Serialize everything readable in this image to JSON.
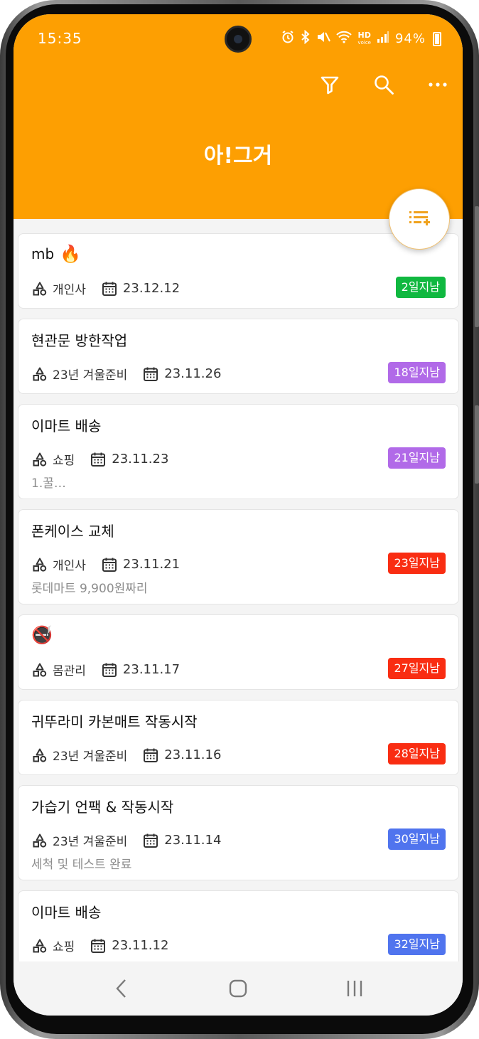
{
  "status_bar": {
    "time": "15:35",
    "battery": "94%",
    "hd_label": "HD",
    "hd_sub": "voice"
  },
  "header": {
    "title": "아!그거",
    "toolbar": [
      "filter-icon",
      "search-icon",
      "more-icon"
    ],
    "color": "#fd9f02"
  },
  "fab": {
    "icon": "add-list-icon"
  },
  "items": [
    {
      "title": "mb",
      "emoji": "🔥",
      "category": "개인사",
      "date": "23.12.12",
      "badge": "2일지남",
      "badge_color": "#10b840",
      "memo": ""
    },
    {
      "title": "현관문 방한작업",
      "emoji": "",
      "category": "23년 겨울준비",
      "date": "23.11.26",
      "badge": "18일지남",
      "badge_color": "#b16ae8",
      "memo": ""
    },
    {
      "title": "이마트 배송",
      "emoji": "",
      "category": "쇼핑",
      "date": "23.11.23",
      "badge": "21일지남",
      "badge_color": "#b16ae8",
      "memo": "1.꿀…"
    },
    {
      "title": "폰케이스 교체",
      "emoji": "",
      "category": "개인사",
      "date": "23.11.21",
      "badge": "23일지남",
      "badge_color": "#f92d12",
      "memo": "롯데마트 9,900원짜리"
    },
    {
      "title": "",
      "emoji": "🚭",
      "category": "몸관리",
      "date": "23.11.17",
      "badge": "27일지남",
      "badge_color": "#f92d12",
      "memo": ""
    },
    {
      "title": "귀뚜라미 카본매트 작동시작",
      "emoji": "",
      "category": "23년 겨울준비",
      "date": "23.11.16",
      "badge": "28일지남",
      "badge_color": "#f92d12",
      "memo": ""
    },
    {
      "title": "가습기 언팩 & 작동시작",
      "emoji": "",
      "category": "23년 겨울준비",
      "date": "23.11.14",
      "badge": "30일지남",
      "badge_color": "#5074ee",
      "memo": "세척 및 테스트 완료"
    },
    {
      "title": "이마트 배송",
      "emoji": "",
      "category": "쇼핑",
      "date": "23.11.12",
      "badge": "32일지남",
      "badge_color": "#5074ee",
      "memo": ""
    }
  ],
  "nav": [
    "back-icon",
    "home-icon",
    "recents-icon"
  ]
}
